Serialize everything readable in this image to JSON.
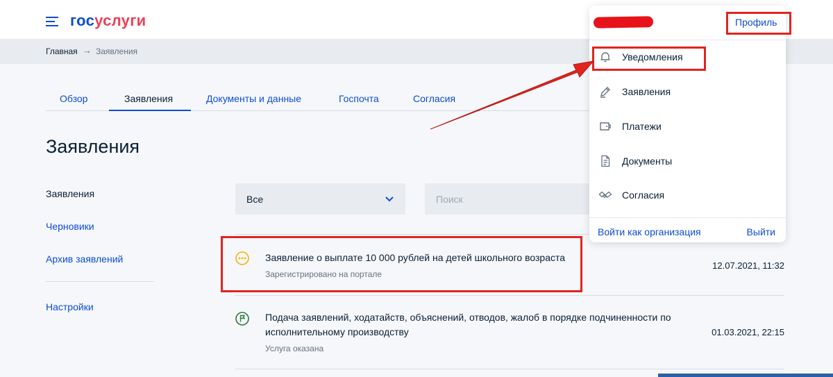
{
  "header": {
    "logo_part1": "гос",
    "logo_part2": "услуги"
  },
  "breadcrumb": {
    "home": "Главная",
    "arrow": "→",
    "current": "Заявления"
  },
  "tabs": [
    {
      "label": "Обзор"
    },
    {
      "label": "Заявления"
    },
    {
      "label": "Документы и данные"
    },
    {
      "label": "Госпочта"
    },
    {
      "label": "Согласия"
    }
  ],
  "page_title": "Заявления",
  "sidebar": {
    "items": [
      {
        "label": "Заявления"
      },
      {
        "label": "Черновики"
      },
      {
        "label": "Архив заявлений"
      },
      {
        "label": "Настройки"
      }
    ]
  },
  "filter": {
    "selected": "Все",
    "search_placeholder": "Поиск"
  },
  "applications": [
    {
      "title": "Заявление о выплате 10 000 рублей на детей школьного возраста",
      "status": "Зарегистрировано на портале",
      "date": "12.07.2021, 11:32",
      "icon": "pending-dots-icon",
      "icon_color": "#f7b500"
    },
    {
      "title": "Подача заявлений, ходатайств, объяснений, отводов, жалоб в порядке подчиненности по исполнительному производству",
      "status": "Услуга оказана",
      "date": "01.03.2021, 22:15",
      "icon": "flag-icon",
      "icon_color": "#2a7a3b"
    }
  ],
  "profile_menu": {
    "profile_link": "Профиль",
    "items": [
      {
        "label": "Уведомления",
        "icon": "bell-icon"
      },
      {
        "label": "Заявления",
        "icon": "pen-icon"
      },
      {
        "label": "Платежи",
        "icon": "wallet-icon"
      },
      {
        "label": "Документы",
        "icon": "document-icon"
      },
      {
        "label": "Согласия",
        "icon": "handshake-icon"
      }
    ],
    "login_as_org": "Войти как организация",
    "logout": "Выйти"
  },
  "colors": {
    "brand_blue": "#0d4cd3",
    "brand_red": "#ee3f58",
    "annotation_red": "#e1241f"
  }
}
